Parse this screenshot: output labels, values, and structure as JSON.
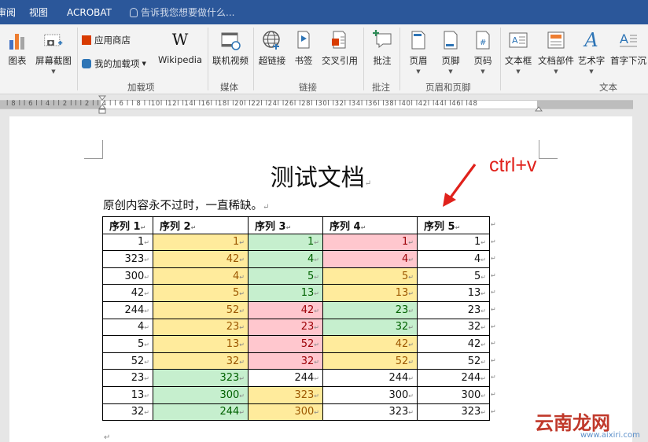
{
  "menubar": {
    "items": [
      "审阅",
      "视图",
      "ACROBAT"
    ],
    "tell_me": "告诉我您想要做什么..."
  },
  "ribbon": {
    "chart_label": "图表",
    "screenshot_label": "屏幕截图",
    "store_label": "应用商店",
    "my_addins_label": "我的加载项",
    "wikipedia_label": "Wikipedia",
    "online_video_label": "联机视频",
    "hyperlink_label": "超链接",
    "bookmark_label": "书签",
    "cross_ref_label": "交叉引用",
    "comment_label": "批注",
    "header_label": "页眉",
    "footer_label": "页脚",
    "page_number_label": "页码",
    "textbox_label": "文本框",
    "quickparts_label": "文档部件",
    "wordart_label": "艺术字",
    "dropcap_label": "首字下沉",
    "groups": {
      "addins": "加载项",
      "media": "媒体",
      "links": "链接",
      "comments": "批注",
      "header_footer": "页眉和页脚",
      "text": "文本"
    }
  },
  "ruler": {
    "marks": "l 8 l  l 6 l  l 4 l  l 2 l      l  l 2 l  l 4 l  l 6 l  l 8 l  l10l  l12l  l14l  l16l  l18l  l20l  l22l  l24l  l26l  l28l  l30l  l32l  l34l  l36l  l38l     l40l  l42l  l44l  l46l  l48"
  },
  "document": {
    "title": "测试文档",
    "subtitle": "原创内容永不过时，一直稀缺。",
    "annotation": "ctrl+v",
    "table": {
      "headers": [
        "序列 1",
        "序列 2",
        "序列 3",
        "序列 4",
        "序列 5"
      ],
      "rows": [
        [
          "1",
          "1",
          "1",
          "1",
          "1"
        ],
        [
          "323",
          "42",
          "4",
          "4",
          "4"
        ],
        [
          "300",
          "4",
          "5",
          "5",
          "5"
        ],
        [
          "42",
          "5",
          "13",
          "13",
          "13"
        ],
        [
          "244",
          "52",
          "42",
          "23",
          "23"
        ],
        [
          "4",
          "23",
          "23",
          "32",
          "32"
        ],
        [
          "5",
          "13",
          "52",
          "42",
          "42"
        ],
        [
          "52",
          "32",
          "32",
          "52",
          "52"
        ],
        [
          "23",
          "323",
          "244",
          "244",
          "244"
        ],
        [
          "13",
          "300",
          "323",
          "300",
          "300"
        ],
        [
          "32",
          "244",
          "300",
          "323",
          "323"
        ]
      ],
      "fills": [
        [
          "",
          "y",
          "g",
          "r",
          ""
        ],
        [
          "",
          "y",
          "g",
          "r",
          ""
        ],
        [
          "",
          "y",
          "g",
          "y",
          ""
        ],
        [
          "",
          "y",
          "g",
          "y",
          ""
        ],
        [
          "",
          "y",
          "r",
          "g",
          ""
        ],
        [
          "",
          "y",
          "r",
          "g",
          ""
        ],
        [
          "",
          "y",
          "r",
          "y",
          ""
        ],
        [
          "",
          "y",
          "r",
          "y",
          ""
        ],
        [
          "",
          "g",
          "",
          "",
          ""
        ],
        [
          "",
          "g",
          "y",
          "",
          ""
        ],
        [
          "",
          "g",
          "y",
          "",
          ""
        ]
      ],
      "colors": {
        "y": {
          "bg": "#ffeb9c",
          "fg": "#9c5700"
        },
        "g": {
          "bg": "#c6efce",
          "fg": "#006100"
        },
        "r": {
          "bg": "#ffc7ce",
          "fg": "#9c0006"
        }
      }
    }
  },
  "watermark": {
    "text": "云南龙网",
    "url": "www.aixiri.com"
  },
  "colors": {
    "menubar": "#2b579a",
    "annotation": "#e0211b"
  }
}
